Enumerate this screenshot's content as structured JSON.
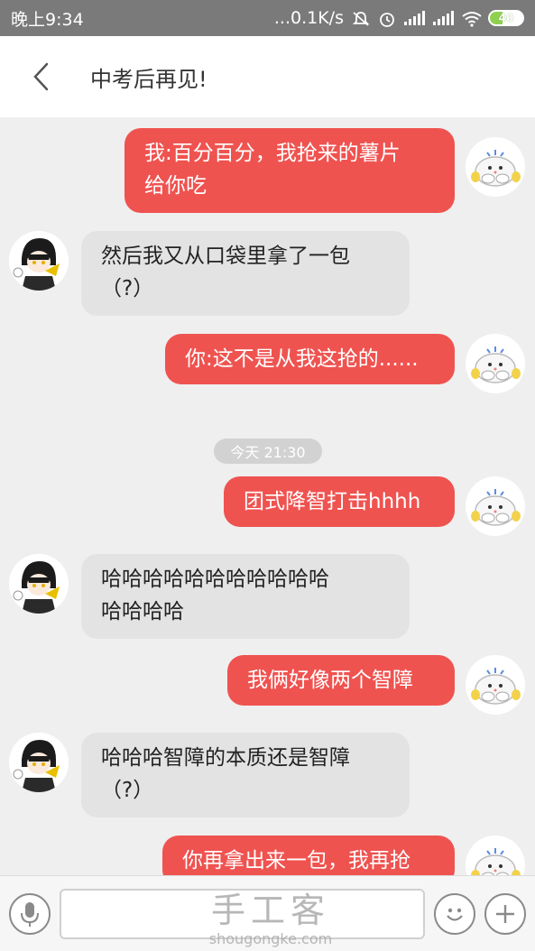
{
  "status_bar": {
    "time": "晚上9:34",
    "network_speed": "...0.1K/s",
    "battery": "40",
    "accent": "#8fd14f"
  },
  "header": {
    "title": "中考后再见!",
    "back_icon": "chevron-left-icon"
  },
  "messages": [
    {
      "from": "me",
      "text_lines": [
        "我:百分百分，我抢来的薯片",
        "给你吃"
      ]
    },
    {
      "from": "other",
      "text_lines": [
        "然后我又从口袋里拿了一包",
        "（?）"
      ]
    },
    {
      "from": "me",
      "text_lines": [
        "你:这不是从我这抢的......"
      ]
    },
    {
      "from": "me",
      "text_lines": [
        "团式降智打击hhhh"
      ]
    },
    {
      "from": "other",
      "text_lines": [
        "哈哈哈哈哈哈哈哈哈哈哈",
        "哈哈哈哈"
      ]
    },
    {
      "from": "me",
      "text_lines": [
        "我俩好像两个智障"
      ]
    },
    {
      "from": "other",
      "text_lines": [
        "哈哈哈智障的本质还是智障",
        "（?）"
      ]
    },
    {
      "from": "me",
      "text_lines": [
        "你再拿出来一包，我再抢"
      ]
    }
  ],
  "timestamp": "今天 21:30",
  "input_bar": {
    "voice_icon": "microphone-icon",
    "emoji_icon": "smiley-icon",
    "plus_icon": "plus-icon"
  },
  "watermark": {
    "brand": "手工客",
    "domain": "shougongke.com"
  },
  "colors": {
    "my_bubble": "#ef5350",
    "other_bubble": "#e3e3e3",
    "background": "#efefef"
  }
}
